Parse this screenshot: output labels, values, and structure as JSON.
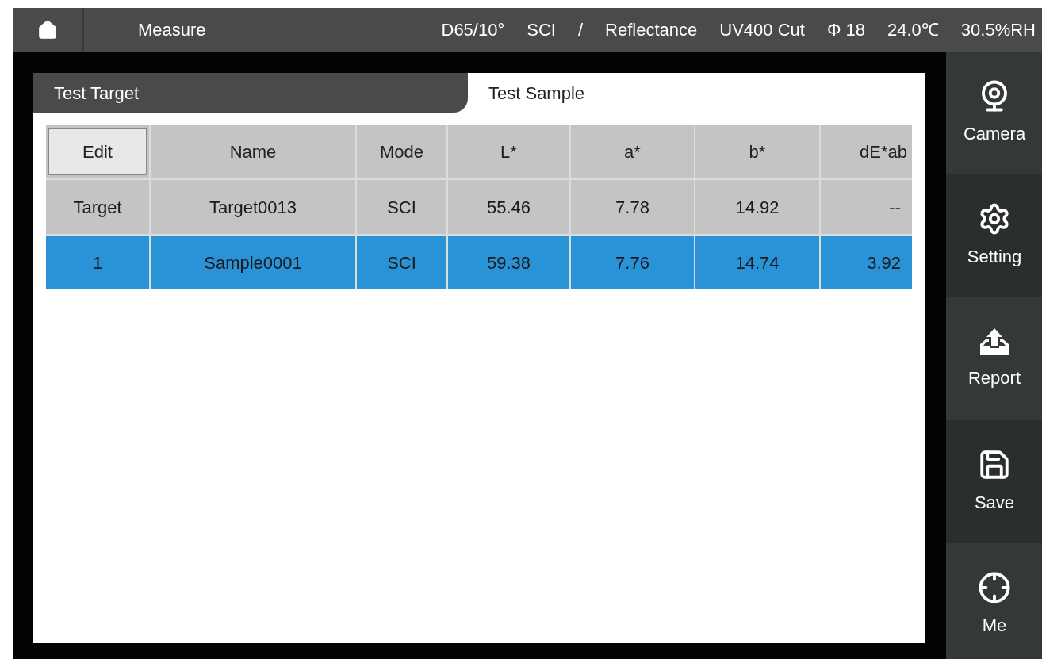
{
  "top_bar": {
    "page": "Measure",
    "status": [
      "D65/10°",
      "SCI",
      "/",
      "Reflectance",
      "UV400 Cut",
      "Φ 18",
      "24.0℃",
      "30.5%RH"
    ]
  },
  "tabs": [
    {
      "label": "Test Target",
      "selected": false
    },
    {
      "label": "Test Sample",
      "selected": true
    }
  ],
  "table": {
    "columns": [
      {
        "label": "Edit",
        "kind": "button"
      },
      {
        "label": "Name",
        "kind": "text"
      },
      {
        "label": "Mode",
        "kind": "text"
      },
      {
        "label": "L*",
        "kind": "text"
      },
      {
        "label": "a*",
        "kind": "text"
      },
      {
        "label": "b*",
        "kind": "text"
      },
      {
        "label": "dE*ab",
        "kind": "text"
      }
    ],
    "rows": [
      {
        "cells": [
          "Target",
          "Target0013",
          "SCI",
          "55.46",
          "7.78",
          "14.92",
          "--"
        ],
        "selected": false
      },
      {
        "cells": [
          "1",
          "Sample0001",
          "SCI",
          "59.38",
          "7.76",
          "14.74",
          "3.92"
        ],
        "selected": true
      }
    ]
  },
  "sidebar": {
    "items": [
      {
        "label": "Camera",
        "kind": "camera"
      },
      {
        "label": "Setting",
        "kind": "setting"
      },
      {
        "label": "Report",
        "kind": "report"
      },
      {
        "label": "Save",
        "kind": "save"
      },
      {
        "label": "Me",
        "kind": "measure"
      }
    ]
  }
}
